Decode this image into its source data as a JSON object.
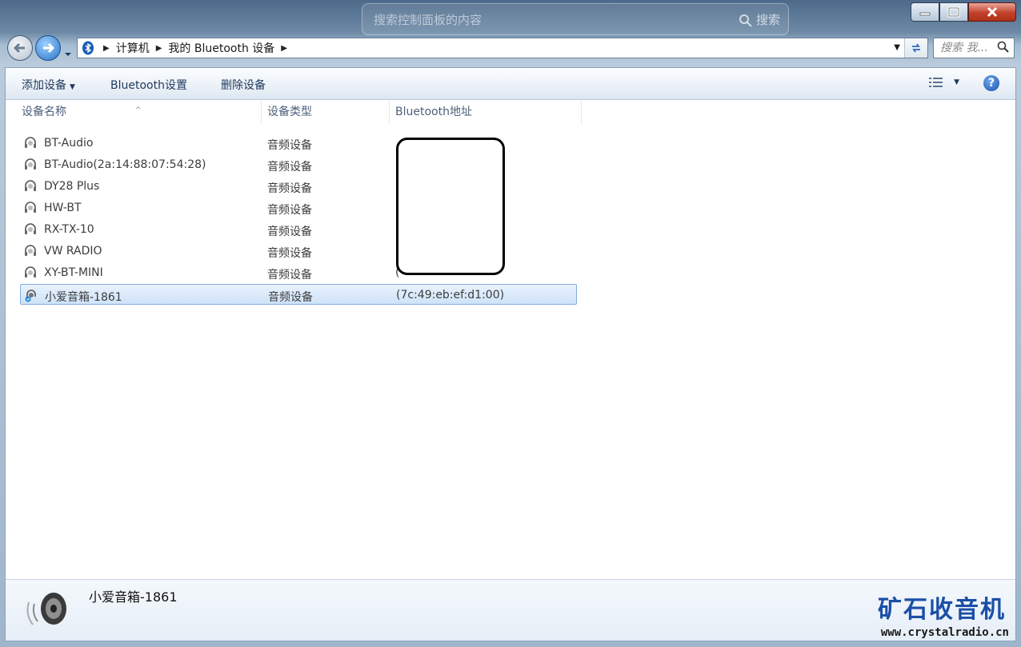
{
  "window": {
    "top_search_placeholder": "搜索控制面板的内容",
    "top_search_button": "搜索"
  },
  "address": {
    "crumbs": [
      "计算机",
      "我的 Bluetooth 设备"
    ]
  },
  "search": {
    "placeholder": "搜索 我..."
  },
  "toolbar": {
    "add_device": "添加设备",
    "bluetooth_settings": "Bluetooth设置",
    "remove_device": "删除设备"
  },
  "columns": {
    "name": "设备名称",
    "type": "设备类型",
    "address": "Bluetooth地址"
  },
  "devices": [
    {
      "name": "BT-Audio",
      "type": "音频设备",
      "address": ""
    },
    {
      "name": "BT-Audio(2a:14:88:07:54:28)",
      "type": "音频设备",
      "address": ""
    },
    {
      "name": "DY28 Plus",
      "type": "音频设备",
      "address": ""
    },
    {
      "name": "HW-BT",
      "type": "音频设备",
      "address": ""
    },
    {
      "name": "RX-TX-10",
      "type": "音频设备",
      "address": ""
    },
    {
      "name": "VW RADIO",
      "type": "音频设备",
      "address": ""
    },
    {
      "name": "XY-BT-MINI",
      "type": "音频设备",
      "address": "("
    },
    {
      "name": "小爱音箱-1861",
      "type": "音频设备",
      "address": "(7c:49:eb:ef:d1:00)",
      "selected": true
    }
  ],
  "details": {
    "selected_name": "小爱音箱-1861"
  },
  "watermark": {
    "brand": "矿石收音机",
    "url": "www.crystalradio.cn"
  },
  "colors": {
    "accent": "#1e395b",
    "selection": "#cfe3f9",
    "watermark": "#1a4fa6"
  },
  "icons": {
    "device": "headset-icon",
    "selected_device": "speaker-connected-icon",
    "details": "speaker-icon"
  }
}
